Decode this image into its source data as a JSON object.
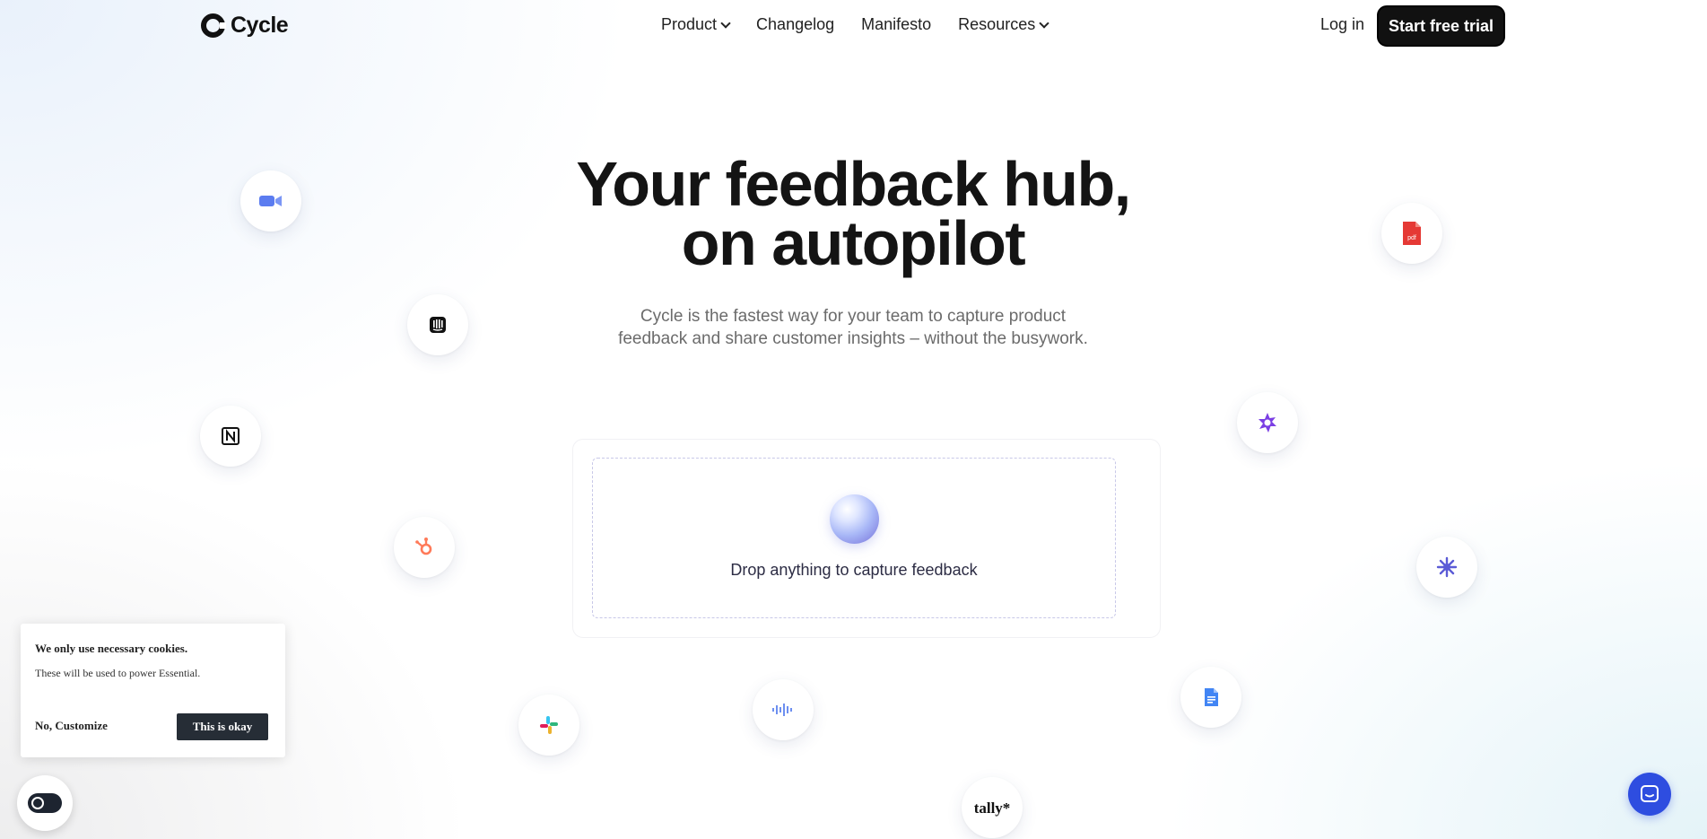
{
  "nav": {
    "logo_text": "Cycle",
    "links": [
      {
        "label": "Product",
        "has_dropdown": true
      },
      {
        "label": "Changelog",
        "has_dropdown": false
      },
      {
        "label": "Manifesto",
        "has_dropdown": false
      },
      {
        "label": "Resources",
        "has_dropdown": true
      }
    ],
    "login_label": "Log in",
    "cta_label": "Start free trial"
  },
  "hero": {
    "title_line1": "Your feedback hub,",
    "title_line2": "on autopilot",
    "subtitle_line1": "Cycle is the fastest way for your team to capture product",
    "subtitle_line2": "feedback and share customer insights – without the busywork."
  },
  "dropzone": {
    "label": "Drop anything to capture feedback"
  },
  "integrations": [
    {
      "name": "video-call-icon",
      "color": "#5b7cf0"
    },
    {
      "name": "intercom-icon",
      "color": "#111111"
    },
    {
      "name": "notion-icon",
      "color": "#111111"
    },
    {
      "name": "hubspot-icon",
      "color": "#ff7a59"
    },
    {
      "name": "slack-icon",
      "color": "#36c5f0"
    },
    {
      "name": "audio-wave-icon",
      "color": "#6d8ff0"
    },
    {
      "name": "tally-logo",
      "label": "tally*",
      "color": "#111111"
    },
    {
      "name": "google-docs-icon",
      "color": "#4285f4"
    },
    {
      "name": "pdf-file-icon",
      "label": "pdf",
      "color": "#e53935"
    },
    {
      "name": "sparkle-badge-icon",
      "color": "#7b3fe4"
    },
    {
      "name": "sun-burst-icon",
      "color": "#5b5bd6"
    }
  ],
  "cookie": {
    "title": "We only use necessary cookies.",
    "body": "These will be used to power Essential.",
    "decline_label": "No, Customize",
    "accept_label": "This is okay"
  },
  "colors": {
    "primary": "#111111",
    "chat_button": "#2e4de0",
    "cookie_button": "#262d36"
  }
}
